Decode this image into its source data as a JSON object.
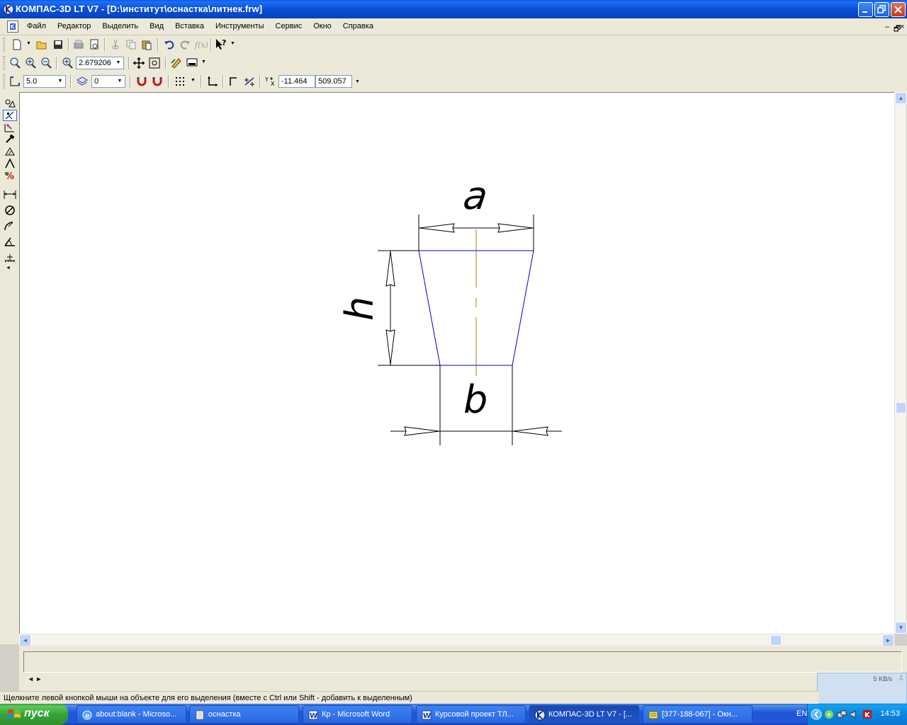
{
  "window": {
    "title": "КОМПАС-3D LT V7 - [D:\\институт\\оснастка\\литнек.frw]"
  },
  "menu": {
    "items": [
      "Файл",
      "Редактор",
      "Выделить",
      "Вид",
      "Вставка",
      "Инструменты",
      "Сервис",
      "Окно",
      "Справка"
    ],
    "mdi_min": "–",
    "mdi_restore": "🗗",
    "mdi_close": "×"
  },
  "toolbar_view": {
    "zoom_value": "2.679206"
  },
  "toolbar_current_state": {
    "step_value": "5.0",
    "layer_value": "0",
    "coord_x": "-11.464",
    "coord_y": "509.057"
  },
  "drawing": {
    "label_a": "a",
    "label_h": "h",
    "label_b": "b",
    "colors": {
      "contour": "#0000c8",
      "axis": "#b08000",
      "dimension": "#000000"
    }
  },
  "status": {
    "hint": "Щелкните левой кнопкой мыши на объекте для его выделения (вместе с Ctrl или Shift - добавить к выделенным)",
    "net_speed": "5 KB/s"
  },
  "taskbar": {
    "start_label": "пуск",
    "tasks": [
      {
        "label": "about:blank - Microso...",
        "icon": "ie-icon"
      },
      {
        "label": "оснастка",
        "icon": "folder-icon"
      },
      {
        "label": "Кр - Microsoft Word",
        "icon": "word-icon"
      },
      {
        "label": "Курсовой проект ТЛ...",
        "icon": "word-icon"
      },
      {
        "label": "КОМПАС-3D LT V7 - [...",
        "icon": "kompas-icon"
      },
      {
        "label": "[377-188-067] - Окн...",
        "icon": "icq-icon"
      }
    ],
    "language": "EN",
    "clock": "14:53"
  }
}
